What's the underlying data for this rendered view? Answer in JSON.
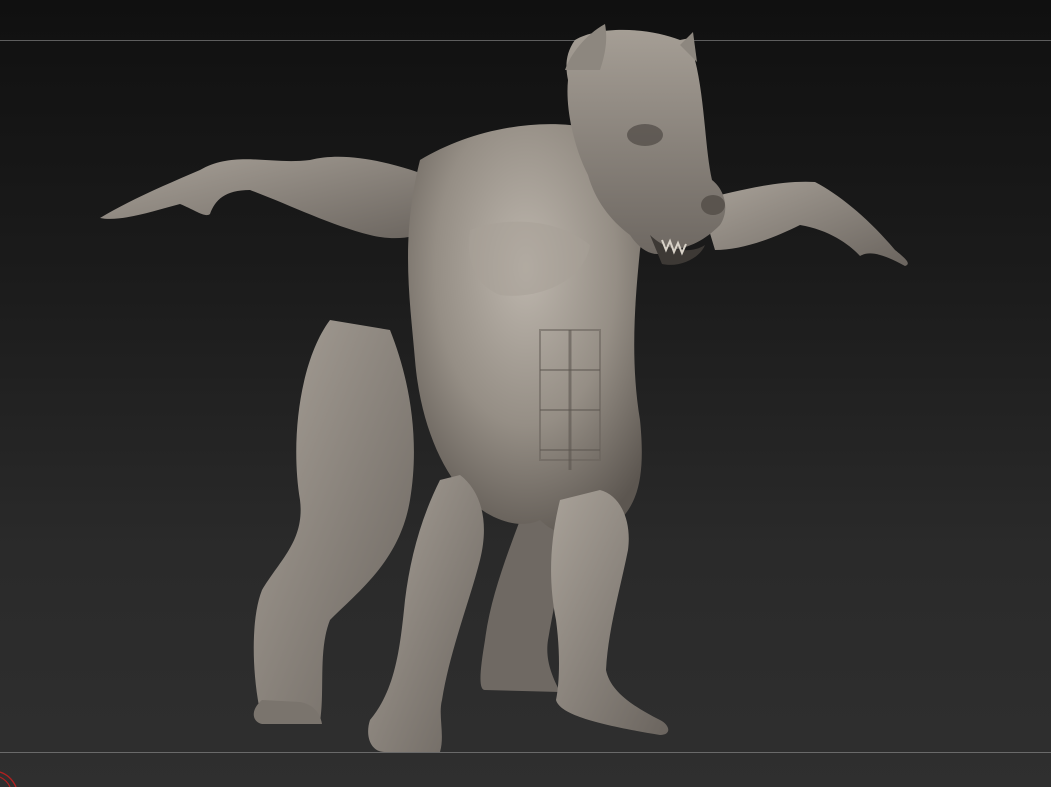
{
  "viewport": {
    "background_top": "#101010",
    "background_bottom": "#2f2f2f",
    "frame_line_color": "#5e5e5e"
  },
  "model": {
    "material_color": "#8f8880",
    "highlight_color": "#b8b1a8",
    "shadow_color": "#4a4540"
  },
  "corner_indicator": {
    "color": "#b02020",
    "icon": "axis-gizmo-icon"
  }
}
